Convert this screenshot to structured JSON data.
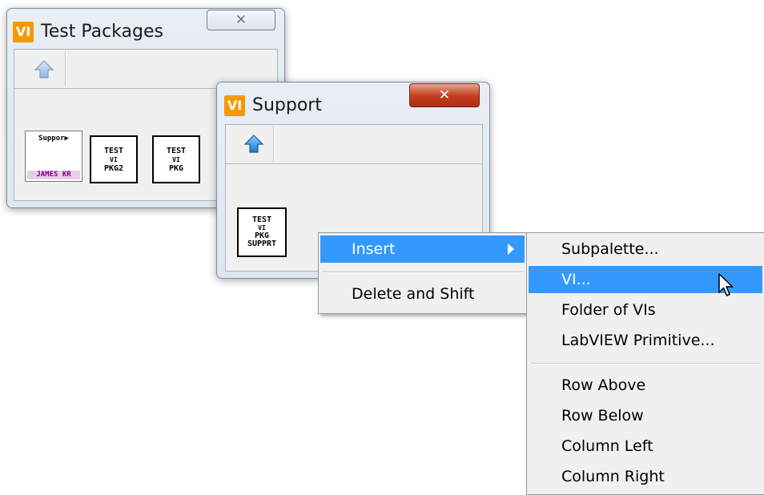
{
  "window_back": {
    "logo": "VI",
    "title": "Test Packages",
    "close": "✕"
  },
  "window_front": {
    "logo": "VI",
    "title": "Support",
    "close": "✕"
  },
  "palette_back_icons": [
    {
      "lines": [
        "Suppor▶"
      ],
      "footer": "JAMES KR"
    },
    {
      "lines": [
        "TEST",
        "VI",
        "PKG2"
      ]
    },
    {
      "lines": [
        "TEST",
        "VI",
        "PKG"
      ]
    }
  ],
  "palette_front_icons": [
    {
      "lines": [
        "TEST",
        "VI",
        "PKG",
        "SUPPRT"
      ]
    }
  ],
  "context_menu": {
    "items": [
      "Insert",
      "Delete and Shift"
    ]
  },
  "submenu": {
    "items": [
      "Subpalette...",
      "VI...",
      "Folder of VIs",
      "LabVIEW Primitive...",
      "Row Above",
      "Row Below",
      "Column Left",
      "Column Right"
    ]
  },
  "colors": {
    "highlight": "#3399ff",
    "vi_logo": "#f49a00",
    "active_close": "#c23b1c"
  }
}
